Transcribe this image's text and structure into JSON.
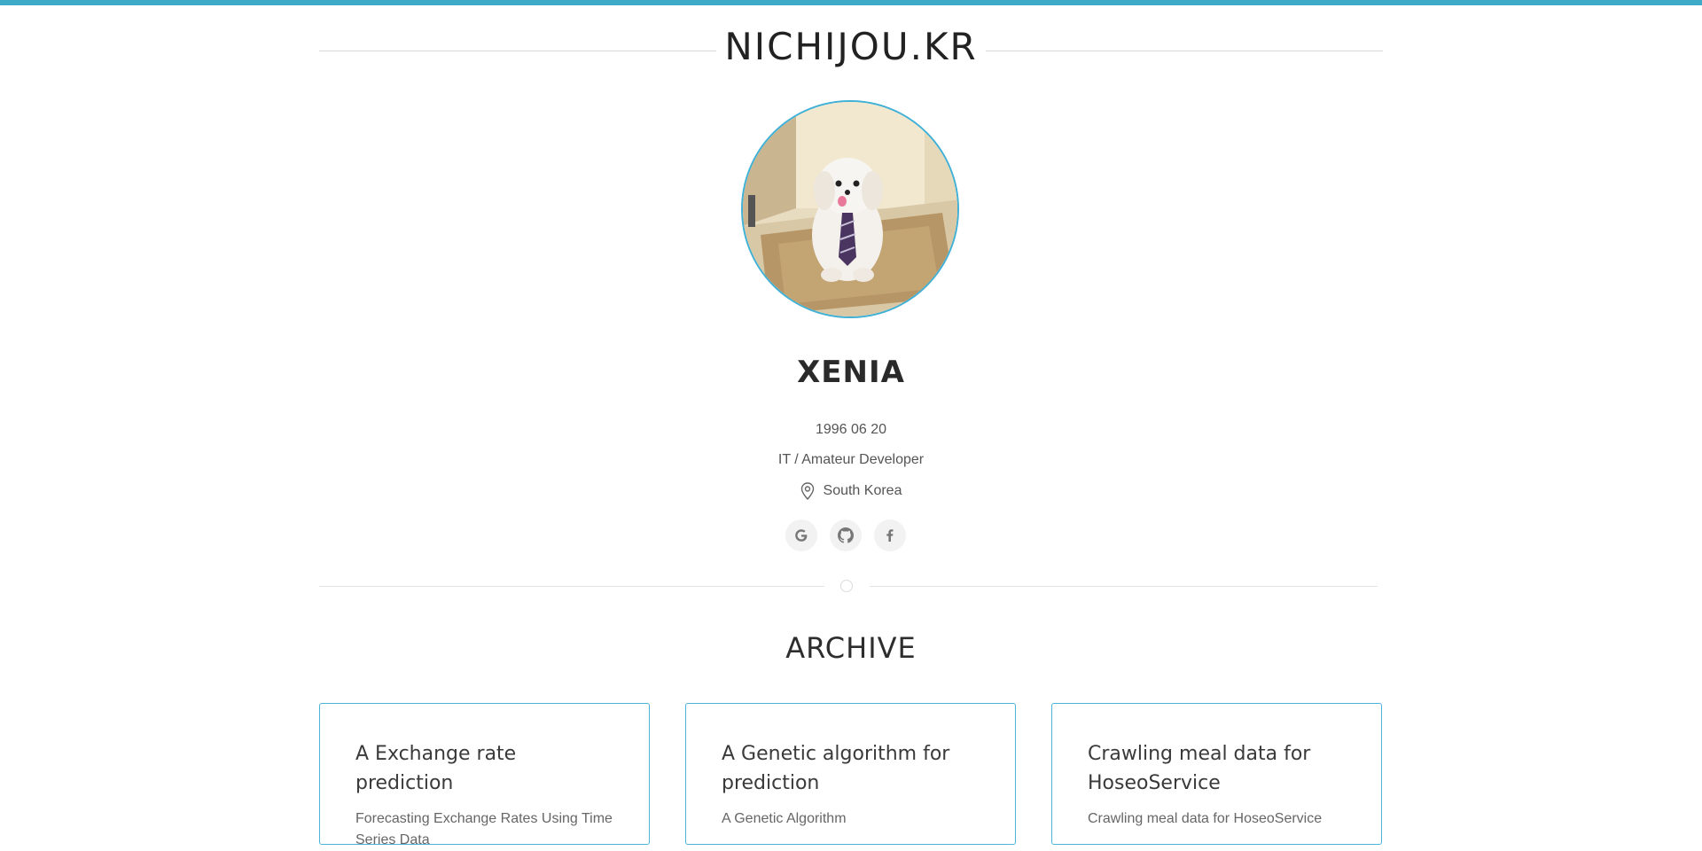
{
  "header": {
    "title": "NICHIJOU.KR"
  },
  "profile": {
    "avatar_icon": "profile-photo-dog",
    "name": "XENIA",
    "birthday": "1996 06 20",
    "occupation": "IT / Amateur Developer",
    "location": "South Korea",
    "location_icon": "map-pin-icon"
  },
  "social": [
    {
      "icon": "google-icon",
      "glyph": "G"
    },
    {
      "icon": "github-icon"
    },
    {
      "icon": "facebook-icon",
      "glyph": "f"
    }
  ],
  "archive": {
    "title": "ARCHIVE",
    "cards": [
      {
        "title": "A Exchange rate prediction",
        "description": "Forecasting Exchange Rates Using Time Series Data"
      },
      {
        "title": "A Genetic algorithm for prediction",
        "description": "A Genetic Algorithm"
      },
      {
        "title": "Crawling meal data for HoseoService",
        "description": "Crawling meal data for HoseoService"
      }
    ]
  },
  "colors": {
    "accent": "#3fa9c8",
    "card_border": "#4ab4d9",
    "text": "#333333"
  }
}
